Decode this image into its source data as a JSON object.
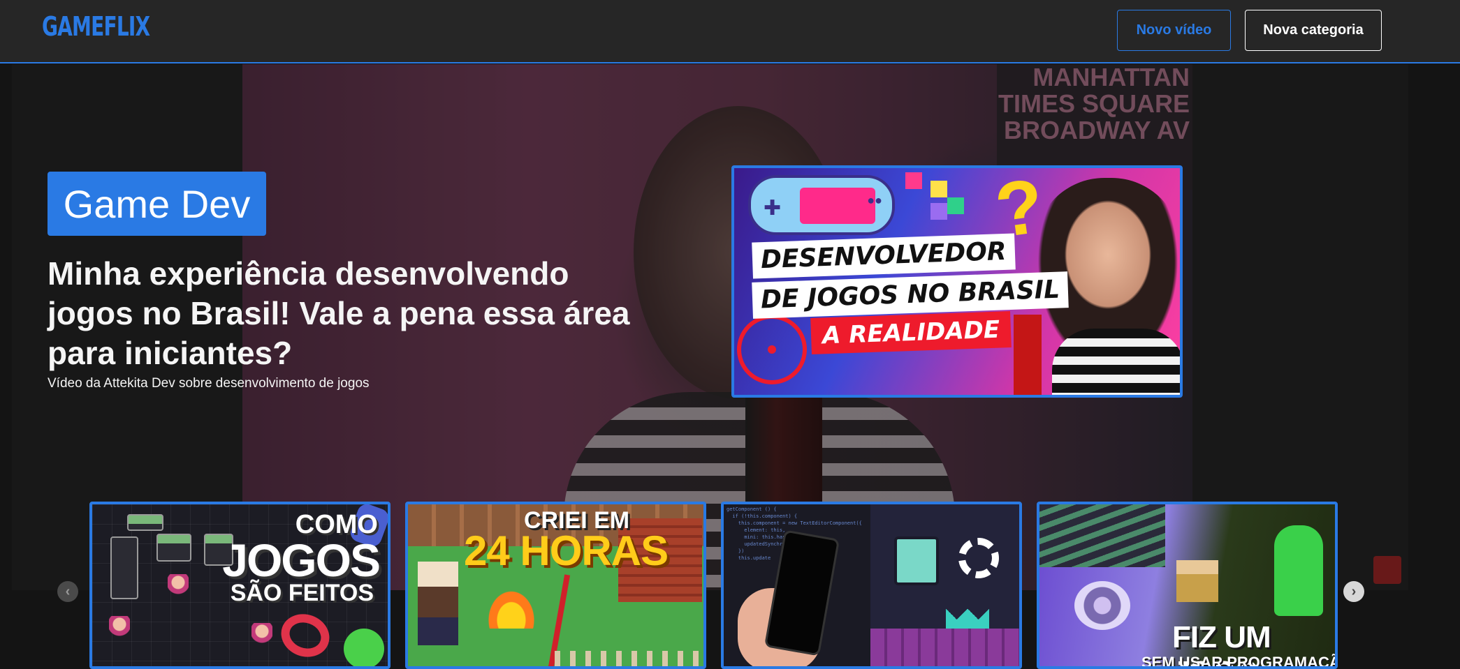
{
  "header": {
    "logo": "GAMEFLIX",
    "new_video_label": "Novo vídeo",
    "new_category_label": "Nova categoria"
  },
  "banner": {
    "category_tag": "Game Dev",
    "title": "Minha experiência desenvolvendo jogos no Brasil! Vale a pena essa área para iniciantes?",
    "description": "Vídeo da Attekita Dev sobre desenvolvimento de jogos",
    "background_wall_text": [
      "MANHATTAN",
      "TIMES SQUARE",
      "BROADWAY AV"
    ],
    "featured_thumbnail": {
      "line1": "DESENVOLVEDOR",
      "line2": "DE JOGOS NO BRASIL",
      "line3": "A REALIDADE"
    }
  },
  "carousel": {
    "cards": [
      {
        "line1": "COMO",
        "line2": "JOGOS",
        "line3": "SÃO FEITOS"
      },
      {
        "line1": "CRIEI EM",
        "line2": "24 HORAS"
      },
      {
        "code_text": "getComponent () {\n  if (!this.component) {\n    this.component = new TextEditorComponent({\n      element: this,\n      mini: this.hasA\n      updatedSynchro\n    })\n    this.update"
      },
      {
        "line1": "FIZ UM JOGO",
        "line2": "SEM USAR PROGRAMAÇÃO"
      }
    ]
  },
  "colors": {
    "accent": "#2a7ae4",
    "header_bg": "#262626",
    "page_bg": "#141414"
  },
  "icons": {
    "prev": "chevron-left-icon",
    "next": "chevron-right-icon"
  }
}
